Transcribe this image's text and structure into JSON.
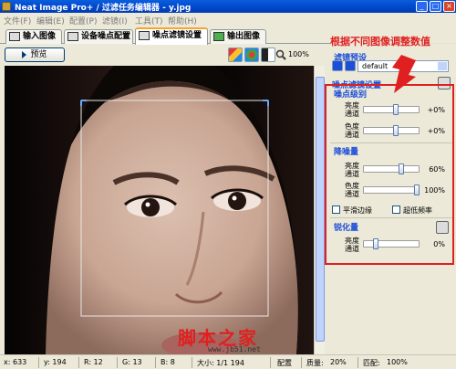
{
  "window": {
    "title": "Neat Image Pro+ / 过滤任务编辑器 - y.jpg",
    "buttons": [
      "_",
      "□",
      "×"
    ]
  },
  "menu": [
    "文件(F)",
    "编辑(E)",
    "配置(P)",
    "滤镜(I)",
    "工具(T)",
    "帮助(H)"
  ],
  "tabs": [
    {
      "label": "输入图像",
      "active": false
    },
    {
      "label": "设备噪点配置",
      "active": false
    },
    {
      "label": "噪点滤镜设置",
      "active": true
    },
    {
      "label": "输出图像",
      "active": false
    }
  ],
  "toolbar": {
    "preview_label": "预览",
    "zoom": "100%"
  },
  "status": {
    "x": "x: 633",
    "y": "y: 194",
    "r": "R: 12",
    "g": "G: 13",
    "b": "B: 8",
    "size": "大小: 1/1 194",
    "profile": "配置",
    "quality_label": "质量:",
    "quality": "20%",
    "match_label": "匹配:",
    "match": "100%"
  },
  "panel": {
    "annotation": "根据不同图像调整数值",
    "preset_title": "滤镜预设",
    "preset_value": "default",
    "noise_filter_title": "噪点滤镜设置",
    "noise_level": {
      "title": "噪点级别",
      "rows": [
        {
          "label_top": "亮度",
          "label_bottom": "通道",
          "value": "+0%",
          "knob_percent": 60
        },
        {
          "label_top": "色度",
          "label_bottom": "通道",
          "value": "+0%",
          "knob_percent": 60
        }
      ]
    },
    "noise_reduction": {
      "title": "降噪量",
      "rows": [
        {
          "label_top": "亮度",
          "label_bottom": "通道",
          "value": "60%",
          "knob_percent": 60
        },
        {
          "label_top": "色度",
          "label_bottom": "通道",
          "value": "100%",
          "knob_percent": 100
        }
      ]
    },
    "checkboxes": [
      {
        "label": "平滑边缘",
        "checked": false
      },
      {
        "label": "超低频率",
        "checked": false
      }
    ],
    "sharpening": {
      "title": "锐化量",
      "rows": [
        {
          "label_top": "亮度",
          "label_bottom": "通道",
          "value": "0%",
          "knob_percent": 0
        }
      ]
    }
  },
  "watermark": {
    "text": "脚本之家",
    "url": "www.jb51.net"
  }
}
